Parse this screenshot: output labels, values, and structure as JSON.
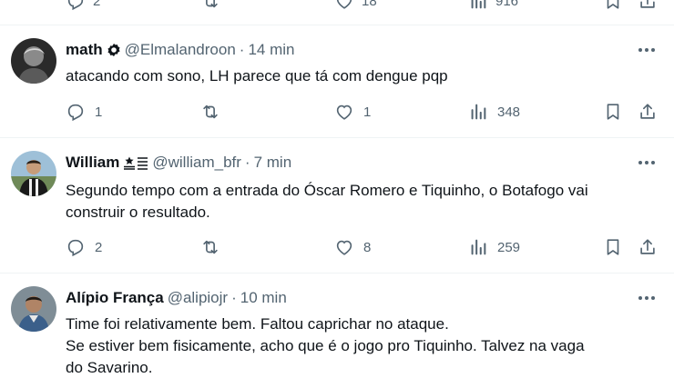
{
  "top_row": {
    "reply_count": "2",
    "like_count": "18",
    "view_count": "916"
  },
  "tweets": [
    {
      "name": "math",
      "handle": "@Elmalandroon",
      "time": "14 min",
      "text_lines": [
        "atacando com sono, LH parece que tá com dengue pqp"
      ],
      "reply_count": "1",
      "retweet_count": "",
      "like_count": "1",
      "view_count": "348"
    },
    {
      "name": "William",
      "handle": "@william_bfr",
      "time": "7 min",
      "text_lines": [
        "Segundo tempo com a entrada do Óscar Romero e Tiquinho, o Botafogo vai",
        "construir o resultado."
      ],
      "reply_count": "2",
      "retweet_count": "",
      "like_count": "8",
      "view_count": "259"
    },
    {
      "name": "Alípio França",
      "handle": "@alipiojr",
      "time": "10 min",
      "text_lines": [
        "Time foi relativamente bem. Faltou caprichar no ataque.",
        "Se estiver bem fisicamente, acho que é o jogo pro Tiquinho. Talvez na vaga",
        "do Savarino."
      ]
    }
  ],
  "separator": "·",
  "colors": {
    "text": "#0f1419",
    "secondary": "#536471",
    "divider": "#eff3f4"
  },
  "icons": [
    "reply-icon",
    "retweet-icon",
    "like-icon",
    "views-icon",
    "bookmark-icon",
    "share-icon",
    "more-icon",
    "verified-badge-icon",
    "emoji-badge-icon"
  ]
}
